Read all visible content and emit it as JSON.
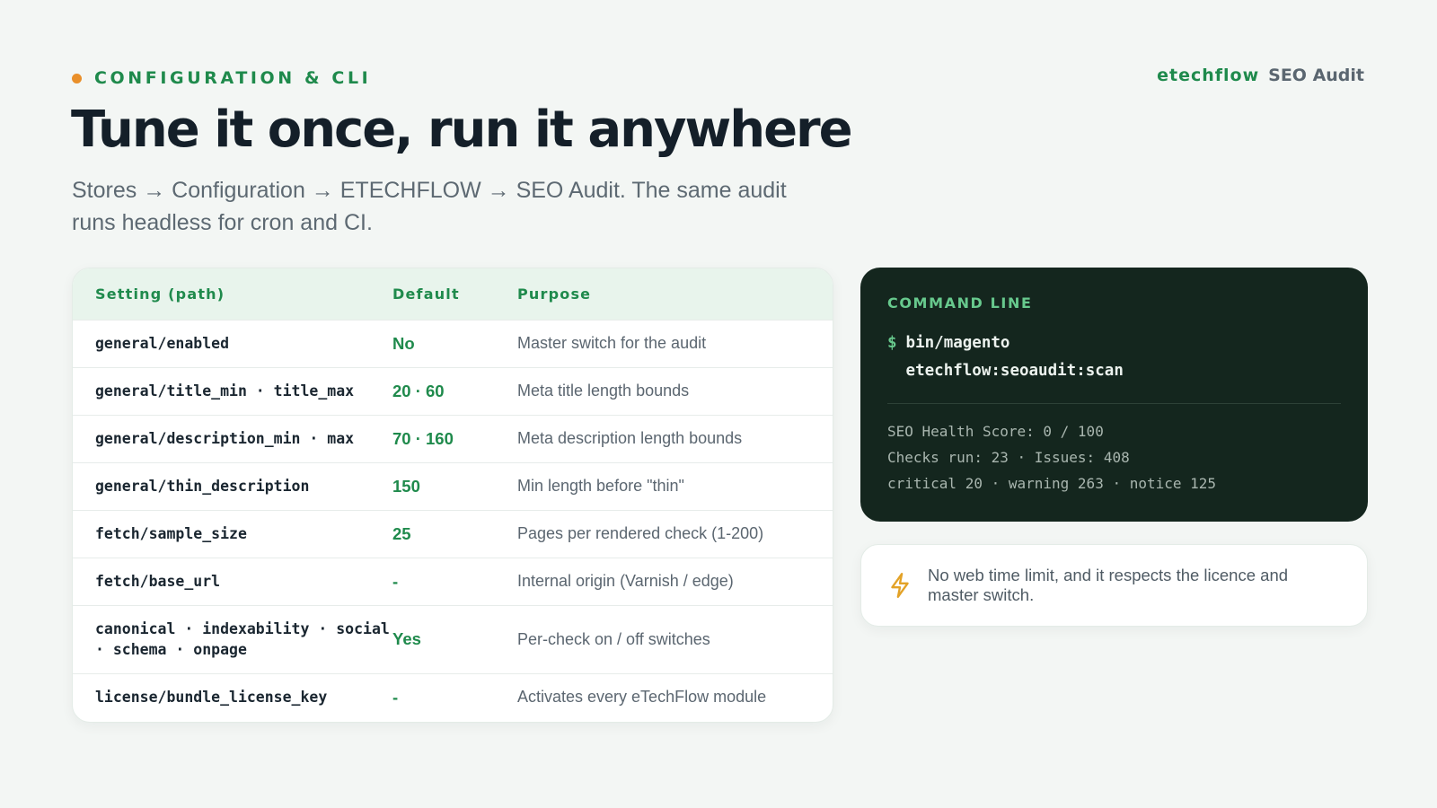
{
  "header": {
    "eyebrow": "CONFIGURATION & CLI",
    "brand_name": "etechflow",
    "brand_product": "SEO Audit",
    "title": "Tune it once, run it anywhere",
    "subtitle": "Stores → Configuration → ETECHFLOW → SEO Audit. The same audit runs headless for cron and CI."
  },
  "table": {
    "columns": [
      "Setting (path)",
      "Default",
      "Purpose"
    ],
    "rows": [
      {
        "setting": "general/enabled",
        "default": "No",
        "purpose": "Master switch for the audit"
      },
      {
        "setting": "general/title_min · title_max",
        "default": "20 · 60",
        "purpose": "Meta title length bounds"
      },
      {
        "setting": "general/description_min · max",
        "default": "70 · 160",
        "purpose": "Meta description length bounds"
      },
      {
        "setting": "general/thin_description",
        "default": "150",
        "purpose": "Min length before \"thin\""
      },
      {
        "setting": "fetch/sample_size",
        "default": "25",
        "purpose": "Pages per rendered check (1-200)"
      },
      {
        "setting": "fetch/base_url",
        "default": "-",
        "purpose": "Internal origin (Varnish / edge)"
      },
      {
        "setting": "canonical · indexability · social · schema · onpage",
        "default": "Yes",
        "purpose": "Per-check on / off switches"
      },
      {
        "setting": "license/bundle_license_key",
        "default": "-",
        "purpose": "Activates every eTechFlow module"
      }
    ]
  },
  "terminal": {
    "heading": "COMMAND LINE",
    "prompt": "$",
    "command_line1": "bin/magento",
    "command_line2": "etechflow:seoaudit:scan",
    "output": [
      "SEO Health Score: 0 / 100",
      "Checks run: 23 · Issues: 408",
      "critical 20 · warning 263 · notice 125"
    ]
  },
  "note": {
    "icon": "lightning-icon",
    "text": "No web time limit, and it respects the licence and master switch."
  },
  "colors": {
    "accent": "#1f8a4c",
    "dot": "#e98f2a",
    "terminal_bg": "#14261e",
    "bolt": "#e3a227"
  }
}
